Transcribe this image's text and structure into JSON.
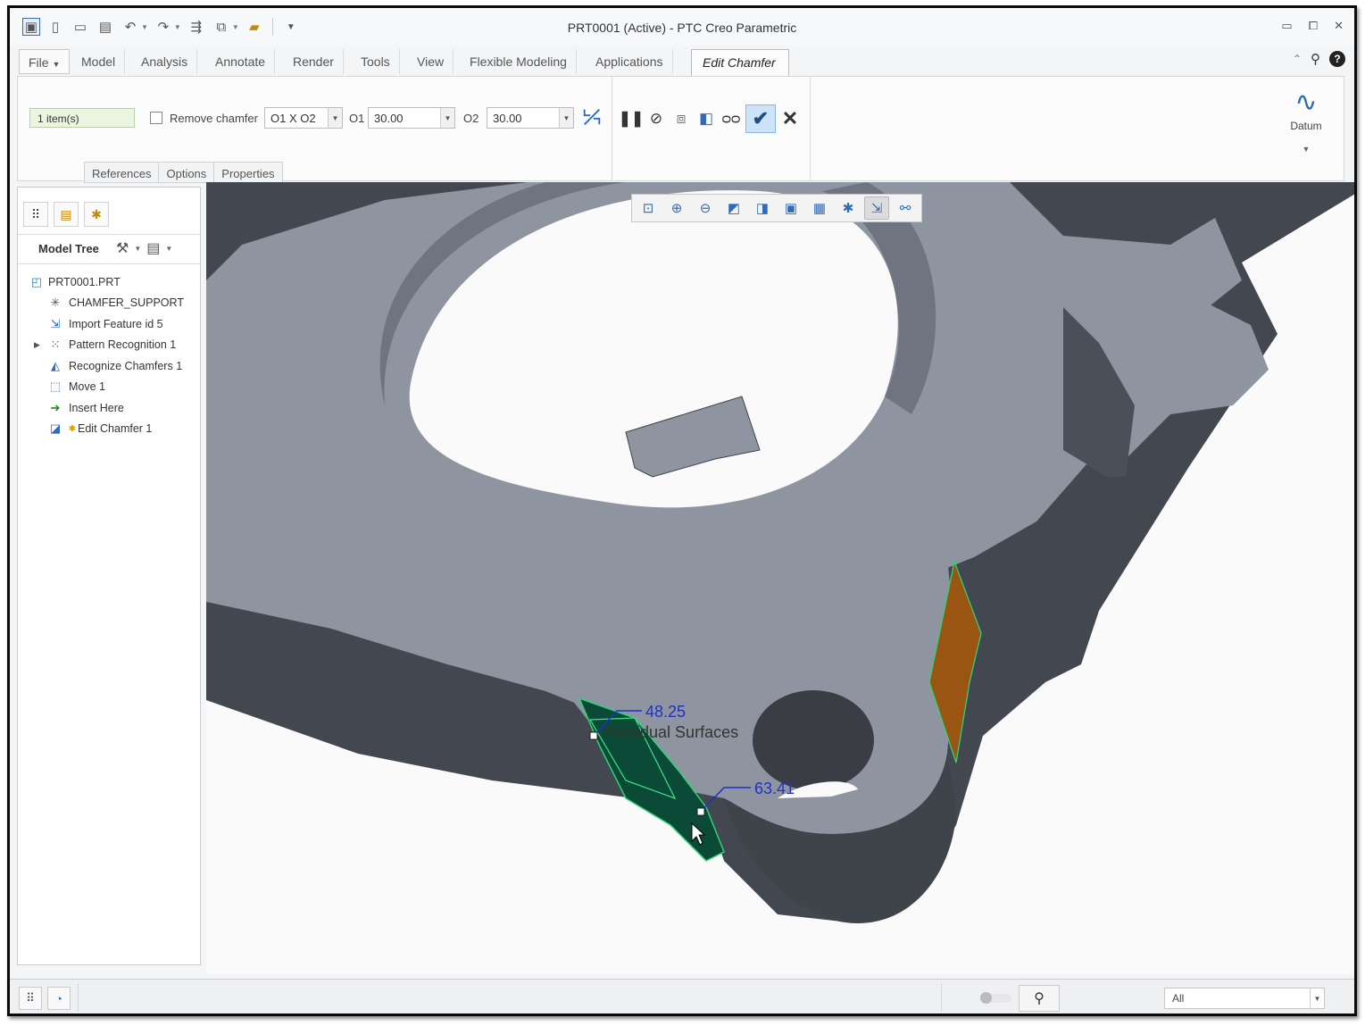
{
  "titlebar": {
    "title": "PRT0001 (Active) - PTC Creo Parametric",
    "quick_access": [
      "app-icon",
      "new-icon",
      "open-icon",
      "save-icon",
      "undo-icon",
      "redo-icon",
      "regenerate-icon",
      "windows-icon",
      "close-window-icon",
      "customize-icon"
    ]
  },
  "ribbon": {
    "tabs": [
      "File",
      "Model",
      "Analysis",
      "Annotate",
      "Render",
      "Tools",
      "View",
      "Flexible Modeling",
      "Applications",
      "Edit Chamfer"
    ],
    "active_tab": "Edit Chamfer"
  },
  "dashboard": {
    "items_value": "1 item(s)",
    "remove_chamfer_label": "Remove chamfer",
    "remove_chamfer_checked": false,
    "scheme_value": "O1 X O2",
    "o1_label": "O1",
    "o1_value": "30.00",
    "o2_label": "O2",
    "o2_value": "30.00",
    "subtabs": [
      "References",
      "Options",
      "Properties"
    ],
    "datum_label": "Datum"
  },
  "model_tree": {
    "title": "Model Tree",
    "nodes": [
      {
        "label": "PRT0001.PRT",
        "icon": "part-icon",
        "expandable": false
      },
      {
        "label": "CHAMFER_SUPPORT",
        "icon": "csys-icon",
        "expandable": false
      },
      {
        "label": "Import Feature id 5",
        "icon": "import-icon",
        "expandable": false
      },
      {
        "label": "Pattern Recognition 1",
        "icon": "pattern-icon",
        "expandable": true
      },
      {
        "label": "Recognize Chamfers 1",
        "icon": "recognize-chamfer-icon",
        "expandable": false
      },
      {
        "label": "Move 1",
        "icon": "move-icon",
        "expandable": false
      },
      {
        "label": "Insert Here",
        "icon": "insert-arrow-icon",
        "expandable": false
      },
      {
        "label": "Edit Chamfer 1",
        "icon": "edit-chamfer-icon",
        "expandable": false
      }
    ]
  },
  "graphics": {
    "toolbar": [
      "refit-icon",
      "zoom-in-icon",
      "zoom-out-icon",
      "repaint-icon",
      "display-style-icon",
      "saved-orientations-icon",
      "view-manager-icon",
      "datum-display-icon",
      "spin-center-icon",
      "annotation-display-icon"
    ],
    "dim_label_1": "48.25",
    "dim_label_2": "63.41",
    "hint_text": "Individual Surfaces",
    "colors": {
      "model_top": "#8e95a0",
      "model_side": "#43474f",
      "chamfer_green": "#0b4a36",
      "chamfer_orange": "#9a5512",
      "dim_blue": "#2030c8"
    }
  },
  "statusbar": {
    "filter_value": "All"
  }
}
